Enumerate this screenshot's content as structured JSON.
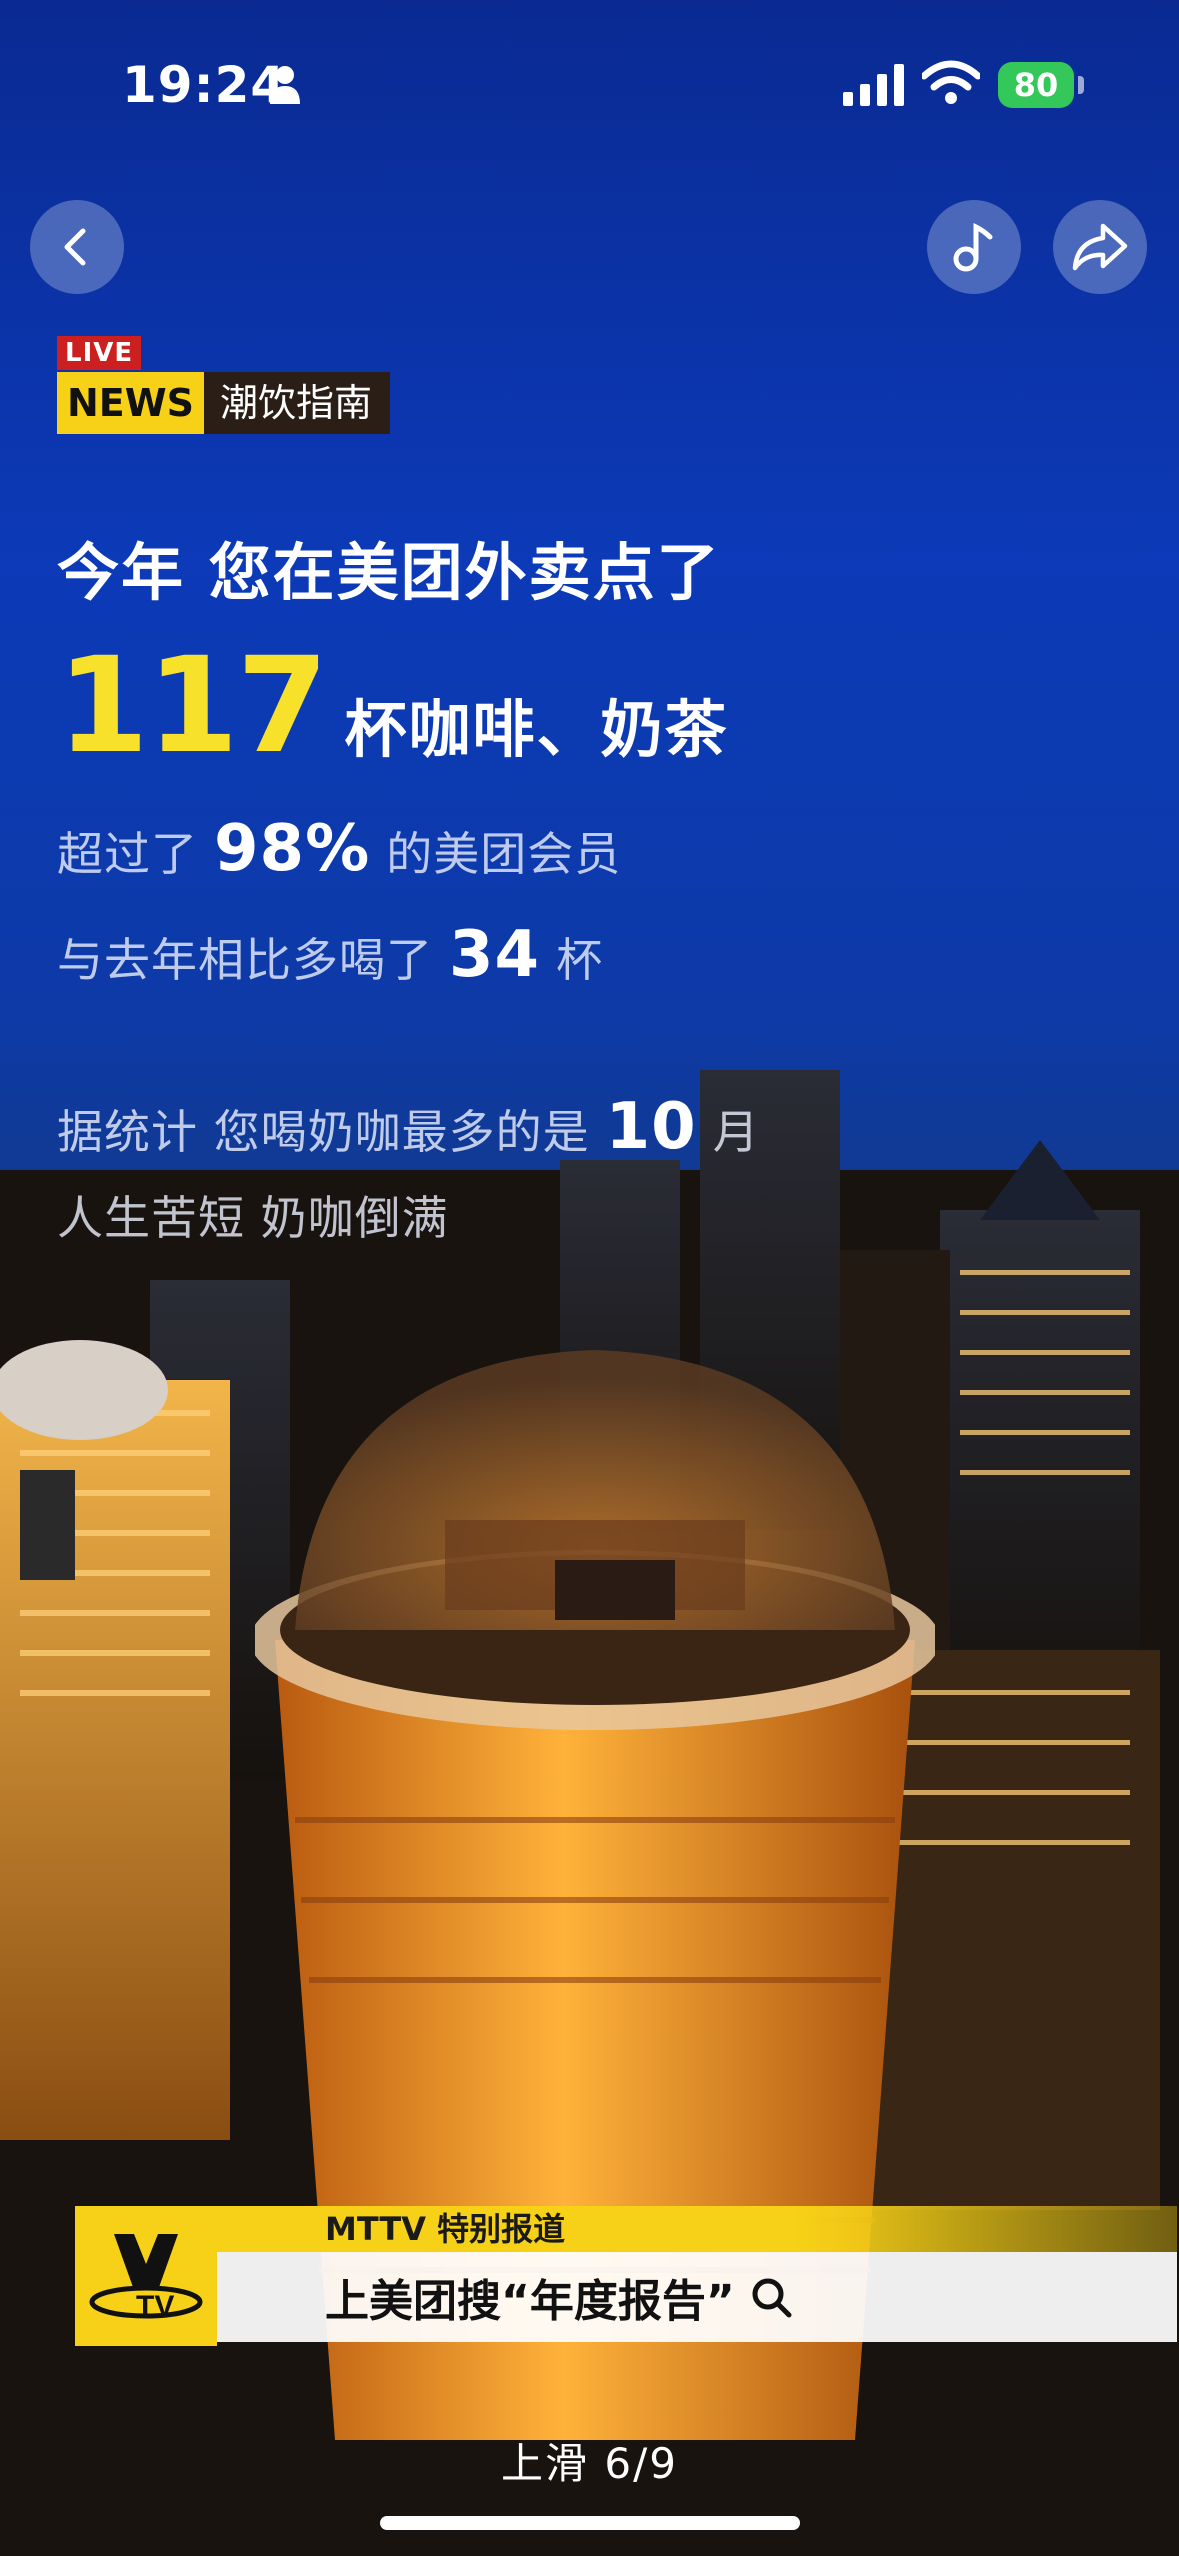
{
  "status_bar": {
    "time": "19:24",
    "battery": "80"
  },
  "header": {
    "back_icon": "chevron-left-icon",
    "music_icon": "music-note-icon",
    "share_icon": "share-arrow-icon"
  },
  "badge": {
    "live": "LIVE",
    "news": "NEWS",
    "topic": "潮饮指南"
  },
  "report": {
    "headline": "今年 您在美团外卖点了",
    "count": "117",
    "count_unit": "杯咖啡、奶茶",
    "exceed_prefix": "超过了",
    "exceed_value": "98%",
    "exceed_suffix": "的美团会员",
    "compare_prefix": "与去年相比多喝了",
    "compare_value": "34",
    "compare_suffix": "杯",
    "month_prefix": "据统计 您喝奶咖最多的是",
    "month_value": "10",
    "month_suffix": "月",
    "slogan": "人生苦短 奶咖倒满"
  },
  "banner": {
    "logo": "TV",
    "title": "MTTV 特别报道",
    "search_text": "上美团搜“年度报告”"
  },
  "footer": {
    "swipe_hint": "上滑 6/9"
  },
  "colors": {
    "accent_yellow": "#f8e12a",
    "badge_yellow": "#f7d117",
    "live_red": "#cc1f1f",
    "battery_green": "#34c759"
  }
}
